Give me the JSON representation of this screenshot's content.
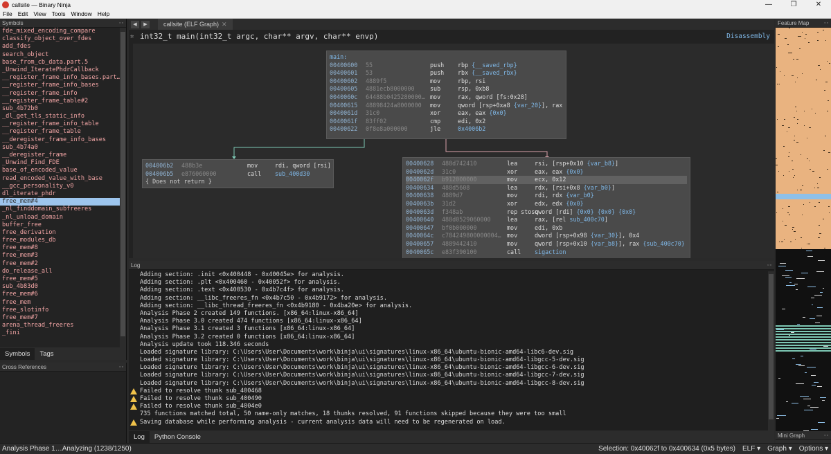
{
  "window": {
    "title": "callsite — Binary Ninja",
    "controls": [
      "—",
      "❐",
      "✕"
    ]
  },
  "menu": [
    "File",
    "Edit",
    "View",
    "Tools",
    "Window",
    "Help"
  ],
  "symbols_panel": {
    "title": "Symbols",
    "items": [
      "fde_mixed_encoding_compare",
      "classify_object_over_fdes",
      "add_fdes",
      "search_object",
      "base_from_cb_data.part.5",
      "_Unwind_IteratePhdrCallback",
      "__register_frame_info_bases.part…",
      "__register_frame_info_bases",
      "__register_frame_info",
      "__register_frame_table#2",
      "sub_4b72b0",
      "_dl_get_tls_static_info",
      "__register_frame_info_table",
      "__register_frame_table",
      "__deregister_frame_info_bases",
      "sub_4b74a0",
      "__deregister_frame",
      "_Unwind_Find_FDE",
      "base_of_encoded_value",
      "read_encoded_value_with_base",
      "__gcc_personality_v0",
      "dl_iterate_phdr",
      "free_mem#4",
      "_nl_finddomain_subfreeres",
      "_nl_unload_domain",
      "buffer_free",
      "free_derivation",
      "free_modules_db",
      "free_mem#8",
      "free_mem#3",
      "free_mem#2",
      "do_release_all",
      "free_mem#5",
      "sub_4b83d0",
      "free_mem#6",
      "free_mem",
      "free_slotinfo",
      "free_mem#7",
      "arena_thread_freeres",
      "_fini"
    ],
    "selected_index": 22,
    "tabs": [
      "Symbols",
      "Tags"
    ]
  },
  "xref_panel": {
    "title": "Cross References"
  },
  "view": {
    "tab_label": "callsite (ELF Graph)",
    "view_type": "Disassembly",
    "function_signature": "int32_t main(int32_t argc, char** argv, char** envp)"
  },
  "blocks": {
    "entry": {
      "label": "main:",
      "lines": [
        {
          "addr": "00400600",
          "bytes": "55",
          "mn": "push",
          "ops": "rbp {__saved_rbp}"
        },
        {
          "addr": "00400601",
          "bytes": "53",
          "mn": "push",
          "ops": "rbx {__saved_rbx}"
        },
        {
          "addr": "00400602",
          "bytes": "4889f5",
          "mn": "mov",
          "ops": "rbp, rsi"
        },
        {
          "addr": "00400605",
          "bytes": "4881ecb8000000",
          "mn": "sub",
          "ops": "rsp, 0xb8"
        },
        {
          "addr": "0040060c",
          "bytes": "64488b0425280000…",
          "mn": "mov",
          "ops": "rax, qword [fs:0x28]"
        },
        {
          "addr": "00400615",
          "bytes": "48898424a8000000",
          "mn": "mov",
          "ops": "qword [rsp+0xa8 {var_20}], rax"
        },
        {
          "addr": "0040061d",
          "bytes": "31c0",
          "mn": "xor",
          "ops": "eax, eax  {0x0}"
        },
        {
          "addr": "0040061f",
          "bytes": "83ff02",
          "mn": "cmp",
          "ops": "edi, 0x2"
        },
        {
          "addr": "00400622",
          "bytes": "0f8e8a000000",
          "mn": "jle",
          "ops": "0x4006b2"
        }
      ]
    },
    "left": {
      "lines": [
        {
          "addr": "004006b2",
          "bytes": "488b3e",
          "mn": "mov",
          "ops": "rdi, qword [rsi]"
        },
        {
          "addr": "004006b5",
          "bytes": "e876060000",
          "mn": "call",
          "ops": "sub_400d30"
        }
      ],
      "note": "{ Does not return }"
    },
    "right": {
      "lines": [
        {
          "addr": "00400628",
          "bytes": "488d742410",
          "mn": "lea",
          "ops": "rsi, [rsp+0x10 {var_b8}]"
        },
        {
          "addr": "0040062d",
          "bytes": "31c0",
          "mn": "xor",
          "ops": "eax, eax  {0x0}"
        },
        {
          "addr": "0040062f",
          "bytes": "b912000000",
          "mn": "mov",
          "ops": "ecx, 0x12"
        },
        {
          "addr": "00400634",
          "bytes": "488d5608",
          "mn": "lea",
          "ops": "rdx, [rsi+0x8 {var_b0}]"
        },
        {
          "addr": "00400638",
          "bytes": "4889d7",
          "mn": "mov",
          "ops": "rdi, rdx {var_b0}"
        },
        {
          "addr": "0040063b",
          "bytes": "31d2",
          "mn": "xor",
          "ops": "edx, edx  {0x0}"
        },
        {
          "addr": "0040063d",
          "bytes": "f348ab",
          "mn": "rep stosq",
          "ops": "qword [rdi]  {0x0}  {0x0}  {0x0}"
        },
        {
          "addr": "00400640",
          "bytes": "488d0529060000",
          "mn": "lea",
          "ops": "rax, [rel sub_400c70]"
        },
        {
          "addr": "00400647",
          "bytes": "bf0b000000",
          "mn": "mov",
          "ops": "edi, 0xb"
        },
        {
          "addr": "0040064c",
          "bytes": "c784249800000004…",
          "mn": "mov",
          "ops": "dword [rsp+0x98 {var_30}], 0x4"
        },
        {
          "addr": "00400657",
          "bytes": "4889442410",
          "mn": "mov",
          "ops": "qword [rsp+0x10 {var_b8}], rax  {sub_400c70}"
        },
        {
          "addr": "0040065c",
          "bytes": "e83f390100",
          "mn": "call",
          "ops": "sigaction"
        }
      ],
      "highlight_index": 2
    }
  },
  "log_panel": {
    "title": "Log",
    "lines": [
      {
        "text": "Adding section: .init <0x400448 - 0x40045e> for analysis.",
        "warn": false
      },
      {
        "text": "Adding section: .plt <0x400460 - 0x40052f> for analysis.",
        "warn": false
      },
      {
        "text": "Adding section: .text <0x400530 - 0x4b7c4f> for analysis.",
        "warn": false
      },
      {
        "text": "Adding section: __libc_freeres_fn <0x4b7c50 - 0x4b9172> for analysis.",
        "warn": false
      },
      {
        "text": "Adding section: __libc_thread_freeres_fn <0x4b9180 - 0x4ba20e> for analysis.",
        "warn": false
      },
      {
        "text": "Analysis Phase 2 created 149 functions. [x86_64:linux-x86_64]",
        "warn": false
      },
      {
        "text": "Analysis Phase 3.0 created 474 functions [x86_64:linux-x86_64]",
        "warn": false
      },
      {
        "text": "Analysis Phase 3.1 created 3 functions [x86_64:linux-x86_64]",
        "warn": false
      },
      {
        "text": "Analysis Phase 3.2 created 0 functions [x86_64:linux-x86_64]",
        "warn": false
      },
      {
        "text": "Analysis update took 118.346 seconds",
        "warn": false
      },
      {
        "text": "Loaded signature library: C:\\Users\\User\\Documents\\work\\binja\\ui\\signatures\\linux-x86_64\\ubuntu-bionic-amd64-libc6-dev.sig",
        "warn": false
      },
      {
        "text": "Loaded signature library: C:\\Users\\User\\Documents\\work\\binja\\ui\\signatures\\linux-x86_64\\ubuntu-bionic-amd64-libgcc-5-dev.sig",
        "warn": false
      },
      {
        "text": "Loaded signature library: C:\\Users\\User\\Documents\\work\\binja\\ui\\signatures\\linux-x86_64\\ubuntu-bionic-amd64-libgcc-6-dev.sig",
        "warn": false
      },
      {
        "text": "Loaded signature library: C:\\Users\\User\\Documents\\work\\binja\\ui\\signatures\\linux-x86_64\\ubuntu-bionic-amd64-libgcc-7-dev.sig",
        "warn": false
      },
      {
        "text": "Loaded signature library: C:\\Users\\User\\Documents\\work\\binja\\ui\\signatures\\linux-x86_64\\ubuntu-bionic-amd64-libgcc-8-dev.sig",
        "warn": false
      },
      {
        "text": "Failed to resolve thunk sub_400468",
        "warn": true
      },
      {
        "text": "Failed to resolve thunk sub_400490",
        "warn": true
      },
      {
        "text": "Failed to resolve thunk sub_4004e0",
        "warn": true
      },
      {
        "text": "735 functions matched total, 50 name-only matches, 18 thunks resolved, 91 functions skipped because they were too small",
        "warn": false
      },
      {
        "text": "Saving database while performing analysis - current analysis data will need to be regenerated on load.",
        "warn": true
      }
    ],
    "tabs": [
      "Log",
      "Python Console"
    ]
  },
  "feature_map": {
    "title": "Feature Map",
    "mini_title": "Mini Graph"
  },
  "status": {
    "left": "Analysis Phase 1…Analyzing (1238/1250)",
    "selection": "Selection: 0x40062f to 0x400634 (0x5 bytes)",
    "platform": "ELF ▾",
    "view_mode": "Graph ▾",
    "options": "Options ▾"
  },
  "colors": {
    "symbol_text": "#f2a5a5",
    "selected_bg": "#9dc5ed",
    "address": "#8fb1d0",
    "token": "#7fb7e6",
    "true_edge": "#7ec9b5",
    "false_edge": "#d9a0a8",
    "feature_map_code": "#e9b380",
    "feature_map_data": "#8ec0e8"
  }
}
